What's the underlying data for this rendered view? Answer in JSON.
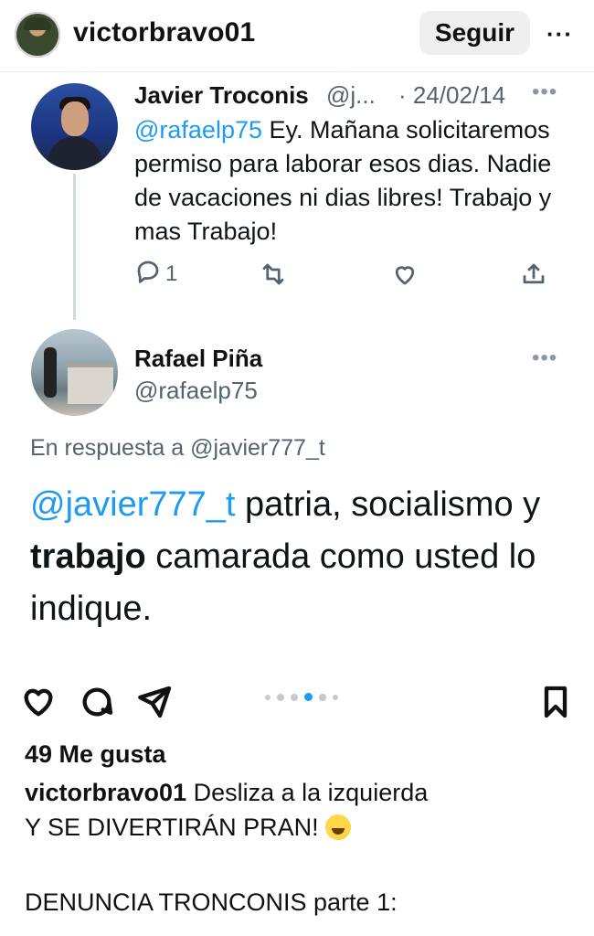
{
  "ig_header": {
    "username": "victorbravo01",
    "follow_label": "Seguir",
    "more_label": "···"
  },
  "tweet1": {
    "name": "Javier Troconis",
    "handle": "@j...",
    "date": "· 24/02/14",
    "more_label": "•••",
    "mention": "@rafaelp75",
    "text": " Ey. Mañana solicitaremos permiso para laborar esos dias. Nadie de vacaciones ni dias libres! Trabajo y mas Trabajo!",
    "reply_count": "1"
  },
  "tweet2": {
    "name": "Rafael Piña",
    "handle": "@rafaelp75",
    "more_label": "•••",
    "reply_prefix": "En respuesta a ",
    "reply_target": "@javier777_t",
    "mention": "@javier777_t",
    "text_part1": "  patria, socialismo y ",
    "bold_word": "trabajo",
    "text_part2": " camarada como usted lo indique."
  },
  "ig_post": {
    "likes": "49 Me gusta",
    "caption_user": "victorbravo01",
    "caption_text_line1": " Desliza a la  izquierda",
    "caption_text_line2": "Y SE DIVERTIRÁN PRAN! ",
    "caption_line3": "DENUNCIA TRONCONIS parte 1:",
    "carousel_active_index": 3,
    "carousel_count": 6
  },
  "icons": {
    "like": "heart-icon",
    "comment": "comment-icon",
    "share": "send-icon",
    "save": "bookmark-icon"
  },
  "colors": {
    "mention": "#1d9bf0",
    "secondary_text": "#536471",
    "follow_bg": "#efefef"
  }
}
